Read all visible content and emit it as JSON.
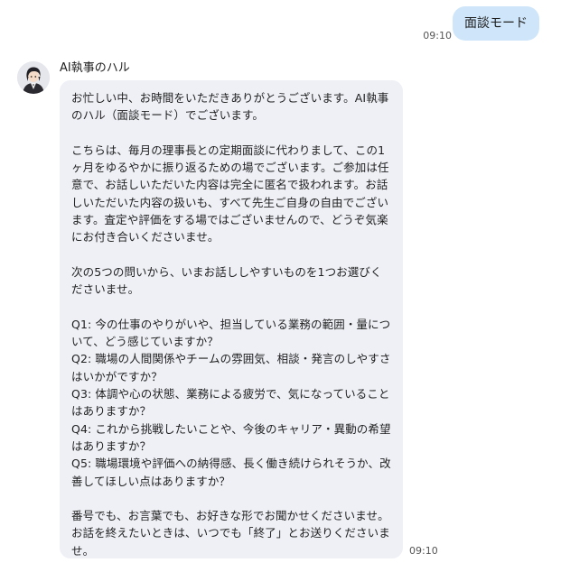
{
  "outgoing": {
    "text": "面談モード",
    "time": "09:10"
  },
  "incoming": {
    "sender": "AI執事のハル",
    "avatar_icon": "butler-avatar-icon",
    "time": "09:10",
    "message": "お忙しい中、お時間をいただきありがとうございます。AI執事のハル（面談モード）でございます。\n\nこちらは、毎月の理事長との定期面談に代わりまして、この1ヶ月をゆるやかに振り返るための場でございます。ご参加は任意で、お話しいただいた内容は完全に匿名で扱われます。お話しいただいた内容の扱いも、すべて先生ご自身の自由でございます。査定や評価をする場ではございませんので、どうぞ気楽にお付き合いくださいませ。\n\n次の5つの問いから、いまお話ししやすいものを1つお選びくださいませ。\n\nQ1: 今の仕事のやりがいや、担当している業務の範囲・量について、どう感じていますか？\nQ2: 職場の人間関係やチームの雰囲気、相談・発言のしやすさはいかがですか？\nQ3: 体調や心の状態、業務による疲労で、気になっていることはありますか？\nQ4: これから挑戦したいことや、今後のキャリア・異動の希望はありますか？\nQ5: 職場環境や評価への納得感、長く働き続けられそうか、改善してほしい点はありますか？\n\n番号でも、お言葉でも、お好きな形でお聞かせくださいませ。お話を終えたいときは、いつでも「終了」とお送りくださいませ。"
  },
  "colors": {
    "outgoing_bubble": "#cfe6fa",
    "incoming_bubble": "#eef0f6",
    "background": "#ffffff"
  }
}
